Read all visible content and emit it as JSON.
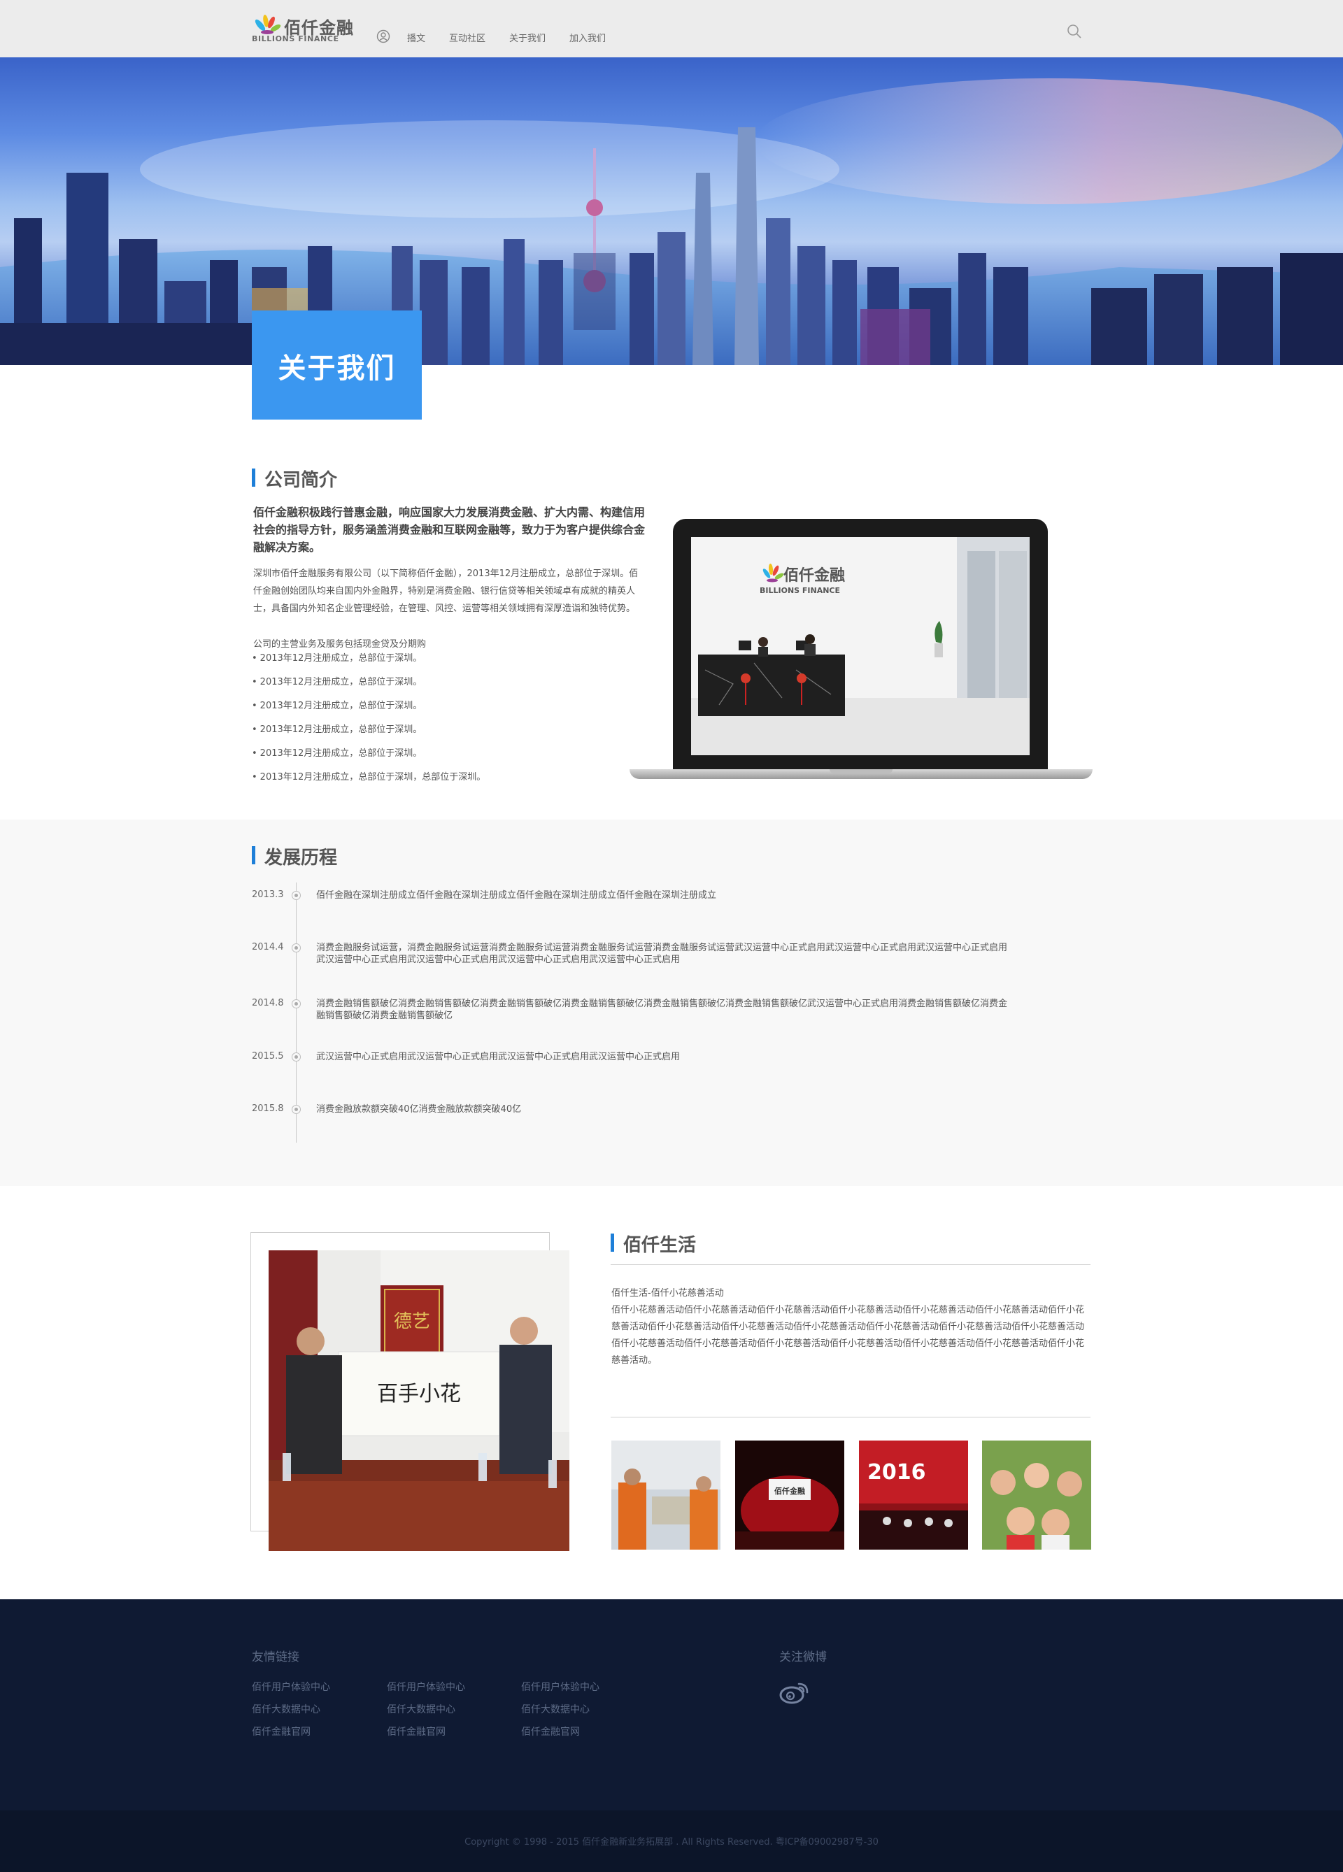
{
  "header": {
    "logo_cn": "佰仟金融",
    "logo_en": "BILLIONS FINANCE",
    "nav": [
      "播文",
      "互动社区",
      "关于我们",
      "加入我们"
    ]
  },
  "banner": {
    "page_title": "关于我们"
  },
  "intro": {
    "heading": "公司简介",
    "lead": "佰仟金融积极践行普惠金融，响应国家大力发展消费金融、扩大内需、构建信用社会的指导方针，服务涵盖消费金融和互联网金融等，致力于为客户提供综合金融解决方案。",
    "body": "深圳市佰仟金融服务有限公司（以下简称佰仟金融），2013年12月注册成立，总部位于深圳。佰仟金融创始团队均来自国内外金融界，特别是消费金融、银行信贷等相关领域卓有成就的精英人士，具备国内外知名企业管理经验，在管理、风控、运营等相关领域拥有深厚造诣和独特优势。",
    "sub": "公司的主营业务及服务包括现金贷及分期购",
    "bullets": [
      "2013年12月注册成立，总部位于深圳。",
      "2013年12月注册成立，总部位于深圳。",
      "2013年12月注册成立，总部位于深圳。",
      "2013年12月注册成立，总部位于深圳。",
      "2013年12月注册成立，总部位于深圳。",
      "2013年12月注册成立，总部位于深圳，总部位于深圳。"
    ],
    "screen_logo_cn": "佰仟金融",
    "screen_logo_en": "BILLIONS FINANCE"
  },
  "history": {
    "heading": "发展历程",
    "items": [
      {
        "date": "2013.3",
        "text": "佰仟金融在深圳注册成立佰仟金融在深圳注册成立佰仟金融在深圳注册成立佰仟金融在深圳注册成立"
      },
      {
        "date": "2014.4",
        "text": "消费金融服务试运营，消费金融服务试运营消费金融服务试运营消费金融服务试运营消费金融服务试运营武汉运营中心正式启用武汉运营中心正式启用武汉运营中心正式启用武汉运营中心正式启用武汉运营中心正式启用武汉运营中心正式启用武汉运营中心正式启用"
      },
      {
        "date": "2014.8",
        "text": "消费金融销售额破亿消费金融销售额破亿消费金融销售额破亿消费金融销售额破亿消费金融销售额破亿消费金融销售额破亿武汉运营中心正式启用消费金融销售额破亿消费金融销售额破亿消费金融销售额破亿"
      },
      {
        "date": "2015.5",
        "text": "武汉运营中心正式启用武汉运营中心正式启用武汉运营中心正式启用武汉运营中心正式启用"
      },
      {
        "date": "2015.8",
        "text": "消费金融放款额突破40亿消费金融放款额突破40亿"
      }
    ]
  },
  "life": {
    "heading": "佰仟生活",
    "title_line": "佰仟生活-佰仟小花慈善活动",
    "body": "佰仟小花慈善活动佰仟小花慈善活动佰仟小花慈善活动佰仟小花慈善活动佰仟小花慈善活动佰仟小花慈善活动佰仟小花慈善活动佰仟小花慈善活动佰仟小花慈善活动佰仟小花慈善活动佰仟小花慈善活动佰仟小花慈善活动佰仟小花慈善活动佰仟小花慈善活动佰仟小花慈善活动佰仟小花慈善活动佰仟小花慈善活动佰仟小花慈善活动佰仟小花慈善活动佰仟小花慈善活动。",
    "photo_banner": "德艺",
    "photo_scroll": "百手小花",
    "thumb_logo": "佰仟金融",
    "thumb_year": "2016"
  },
  "footer": {
    "links_heading": "友情链接",
    "weibo_heading": "关注微博",
    "links": [
      [
        "佰仟用户体验中心",
        "佰仟用户体验中心",
        "佰仟用户体验中心"
      ],
      [
        "佰仟大数据中心",
        "佰仟大数据中心",
        "佰仟大数据中心"
      ],
      [
        "佰仟金融官网",
        "佰仟金融官网",
        "佰仟金融官网"
      ]
    ],
    "copyright": "Copyright © 1998 - 2015 佰仟金融新业务拓展部 . All Rights Reserved. 粤ICP备09002987号-30"
  },
  "colors": {
    "accent": "#3b97f0",
    "heading_bar": "#1e7fd8",
    "footer_bg": "#0f1a33"
  }
}
